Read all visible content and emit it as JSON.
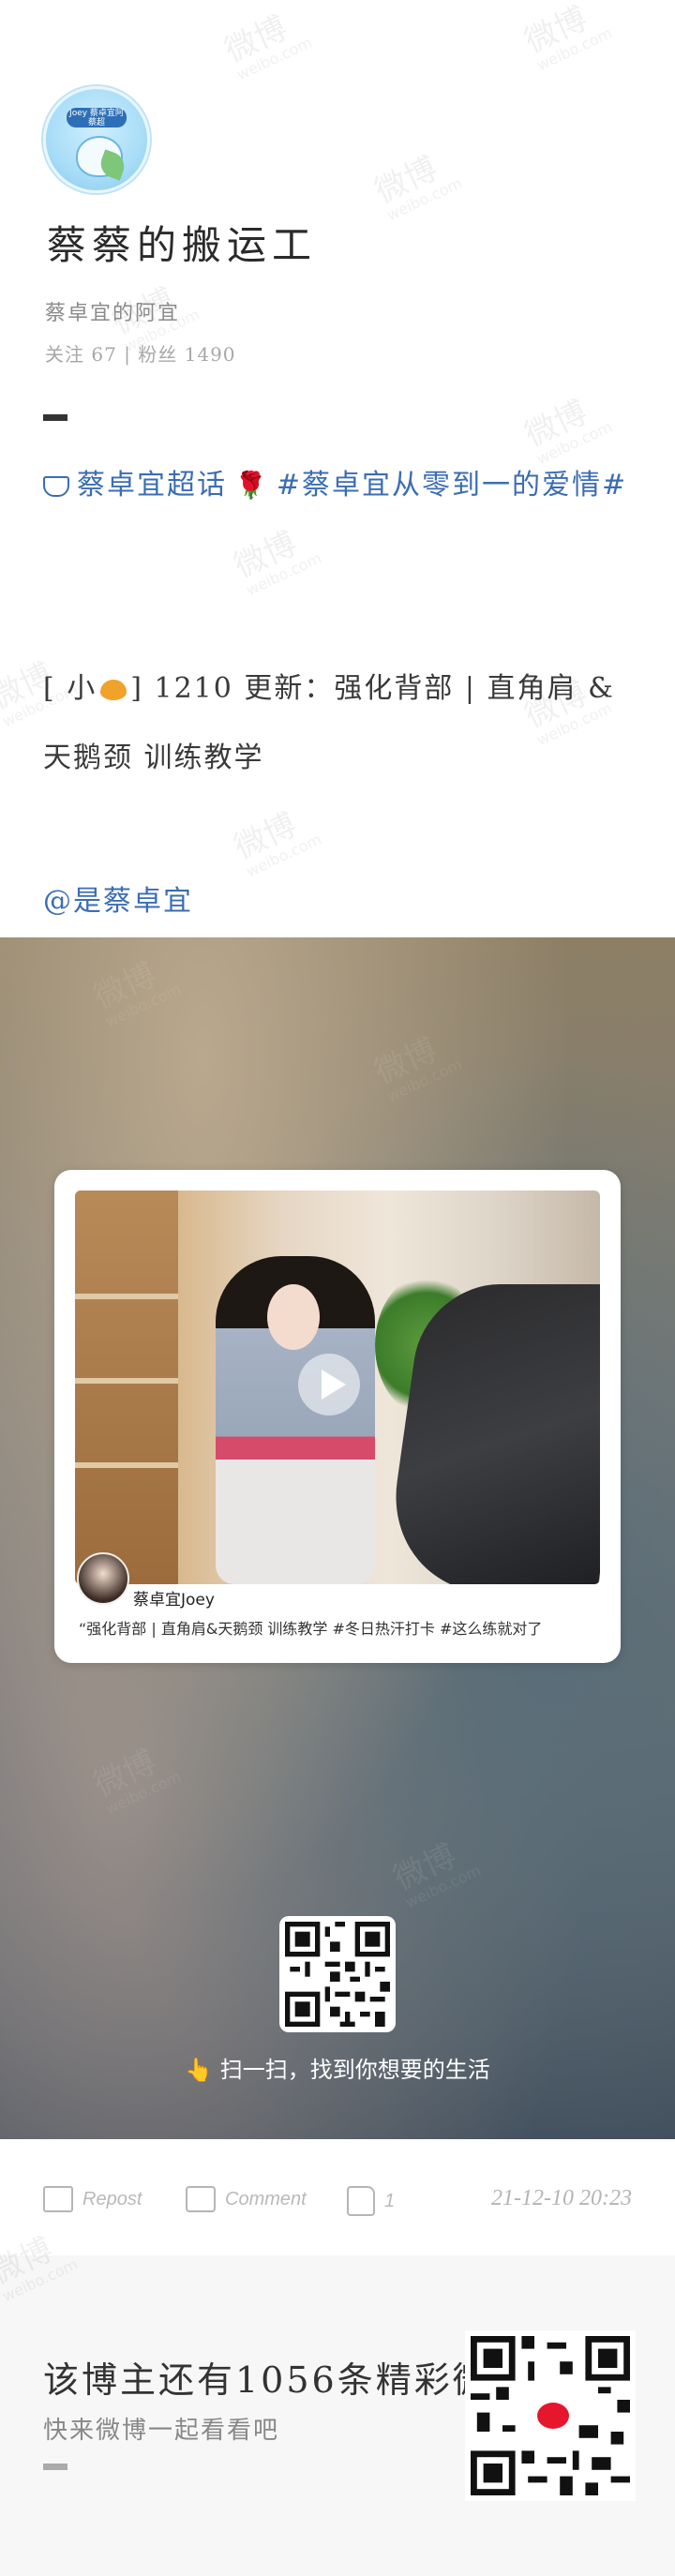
{
  "profile": {
    "avatar_text": "Joey\n蔡卓宜阿蔡超",
    "name": "蔡蔡的搬运工",
    "subtitle": "蔡卓宜的阿宜",
    "stats": "关注 67 | 粉丝 1490"
  },
  "post": {
    "topic": "蔡卓宜超话",
    "hashtag": "#蔡卓宜从零到一的爱情#",
    "update_prefix": "[ 小",
    "update_text": "] 1210 更新：强化背部 | 直角肩 & 天鹅颈 训练教学",
    "mention": "@是蔡卓宜"
  },
  "video": {
    "author": "蔡卓宜Joey",
    "caption": "“强化背部 | 直角肩&天鹅颈 训练教学 #冬日热汗打卡 #这么练就对了"
  },
  "scan": {
    "text": "👆 扫一扫，找到你想要的生活"
  },
  "actions": {
    "repost": "Repost",
    "comment": "Comment",
    "like_count": "1",
    "timestamp": "21-12-10 20:23"
  },
  "promo": {
    "title": "该博主还有1056条精彩微博",
    "subtitle": "快来微博一起看看吧"
  },
  "colors": {
    "link": "#3b6db3",
    "rose": "#d43a3a",
    "weibo_red": "#e6162d"
  },
  "icons": [
    "diamond-icon",
    "rose-icon",
    "heart-icon",
    "play-icon",
    "repost-icon",
    "comment-icon",
    "like-icon",
    "qr-code-icon",
    "weibo-logo-icon"
  ]
}
